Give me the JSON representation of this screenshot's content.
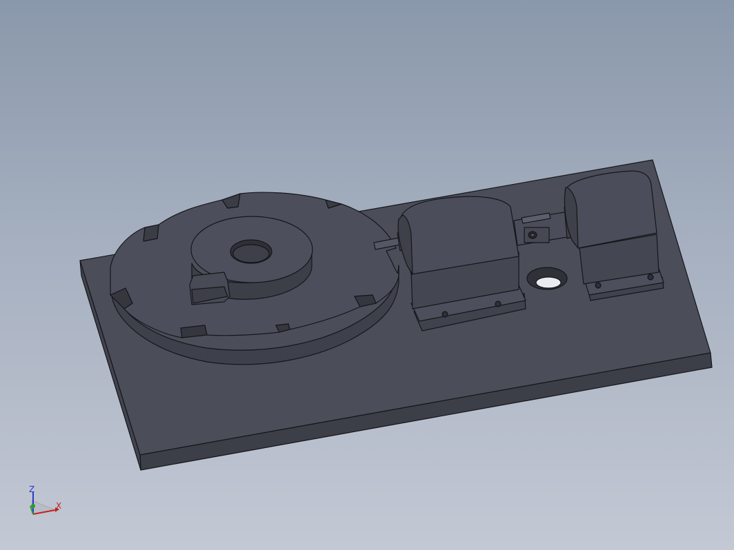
{
  "viewport": {
    "background_top": "#8a98ab",
    "background_bottom": "#c3c8d4"
  },
  "model": {
    "body_color": "#4b4e5a",
    "edge_color": "#15161a",
    "parts": [
      "base-plate",
      "slotted-disc",
      "hub-boss",
      "drive-pin",
      "pillow-block-left",
      "coupling",
      "pillow-block-right",
      "mount-hole"
    ]
  },
  "triad": {
    "z_label": "Z",
    "x_label": "X",
    "z_color": "#2a3cc8",
    "x_color": "#c42020",
    "y_color": "#2a9a2a"
  }
}
